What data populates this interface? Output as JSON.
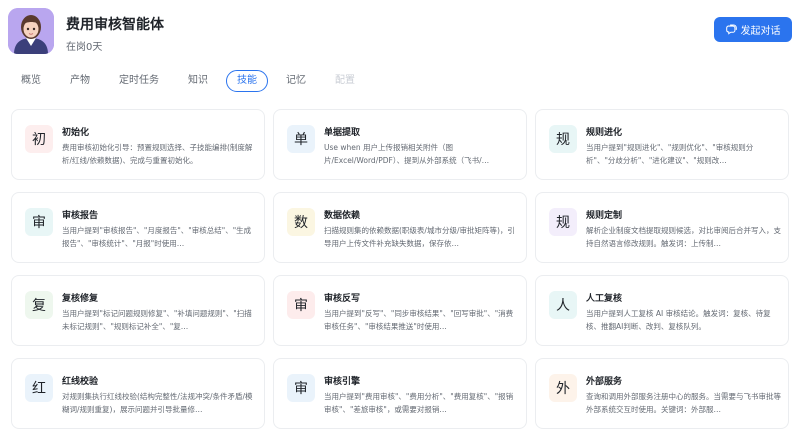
{
  "header": {
    "title": "费用审核智能体",
    "subtitle": "在岗0天",
    "chat_button": "发起对话"
  },
  "tabs": [
    {
      "label": "概览",
      "state": "normal"
    },
    {
      "label": "产物",
      "state": "normal"
    },
    {
      "label": "定时任务",
      "state": "normal"
    },
    {
      "label": "知识",
      "state": "normal"
    },
    {
      "label": "技能",
      "state": "active"
    },
    {
      "label": "记忆",
      "state": "normal"
    },
    {
      "label": "配置",
      "state": "disabled"
    }
  ],
  "skills": [
    {
      "icon": "初",
      "bg": "#fdeeee",
      "title": "初始化",
      "desc": "费用审核初始化引导：预置规则选择、子技能编排(制度解析/红线/依赖数据)、完成与重置初始化。"
    },
    {
      "icon": "单",
      "bg": "#eaf3fb",
      "title": "单据提取",
      "desc": "Use when 用户上传报销相关附件（图片/Excel/Word/PDF）、提到从外部系统（飞书/…"
    },
    {
      "icon": "规",
      "bg": "#e8f6f6",
      "title": "规则进化",
      "desc": "当用户提到\"规则进化\"、\"规则优化\"、\"审核规则分析\"、\"分歧分析\"、\"进化建议\"、\"规则改…"
    },
    {
      "icon": "审",
      "bg": "#e8f6f6",
      "title": "审核报告",
      "desc": "当用户提到\"审核报告\"、\"月度报告\"、\"审核总结\"、\"生成报告\"、\"审核统计\"、\"月报\"时使用…"
    },
    {
      "icon": "数",
      "bg": "#fbf6e2",
      "title": "数据依赖",
      "desc": "扫描规则集的依赖数据(职级表/城市分级/审批矩阵等)，引导用户上传文件补充缺失数据，保存依…"
    },
    {
      "icon": "规",
      "bg": "#f3eefb",
      "title": "规则定制",
      "desc": "解析企业制度文档提取规则候选，对比审阅后合并写入，支持自然语言修改规则。触发词：上传制…"
    },
    {
      "icon": "复",
      "bg": "#eef7ee",
      "title": "复核修复",
      "desc": "当用户提到\"标记问题规则修复\"、\"补填问题规则\"、\"扫描未标记规则\"、\"规则标记补全\"、\"复…"
    },
    {
      "icon": "审",
      "bg": "#fdecec",
      "title": "审核反写",
      "desc": "当用户提到\"反写\"、\"同步审核结果\"、\"回写审批\"、\"消费审核任务\"、\"审核结果推送\"时使用…"
    },
    {
      "icon": "人",
      "bg": "#e8f6f6",
      "title": "人工复核",
      "desc": "当用户提到人工复核 AI 审核结论。触发词：复核、待复核、推翻AI判断、改判、复核队列。"
    },
    {
      "icon": "红",
      "bg": "#eaf3fb",
      "title": "红线校验",
      "desc": "对规则集执行红线校验(结构完整性/法规冲突/条件矛盾/模糊词/规则重复)，展示问题并引导批量修…"
    },
    {
      "icon": "审",
      "bg": "#eef3f9",
      "title": "审核引擎",
      "desc": "当用户提到\"费用审核\"、\"费用分析\"、\"费用复核\"、\"报销审核\"、\"差旅审核\"，或需要对报销…"
    },
    {
      "icon": "外",
      "bg": "#fdf3ea",
      "title": "外部服务",
      "desc": "查询和调用外部服务注册中心的服务。当需要与飞书审批等外部系统交互时使用。关键词：外部服…"
    }
  ]
}
